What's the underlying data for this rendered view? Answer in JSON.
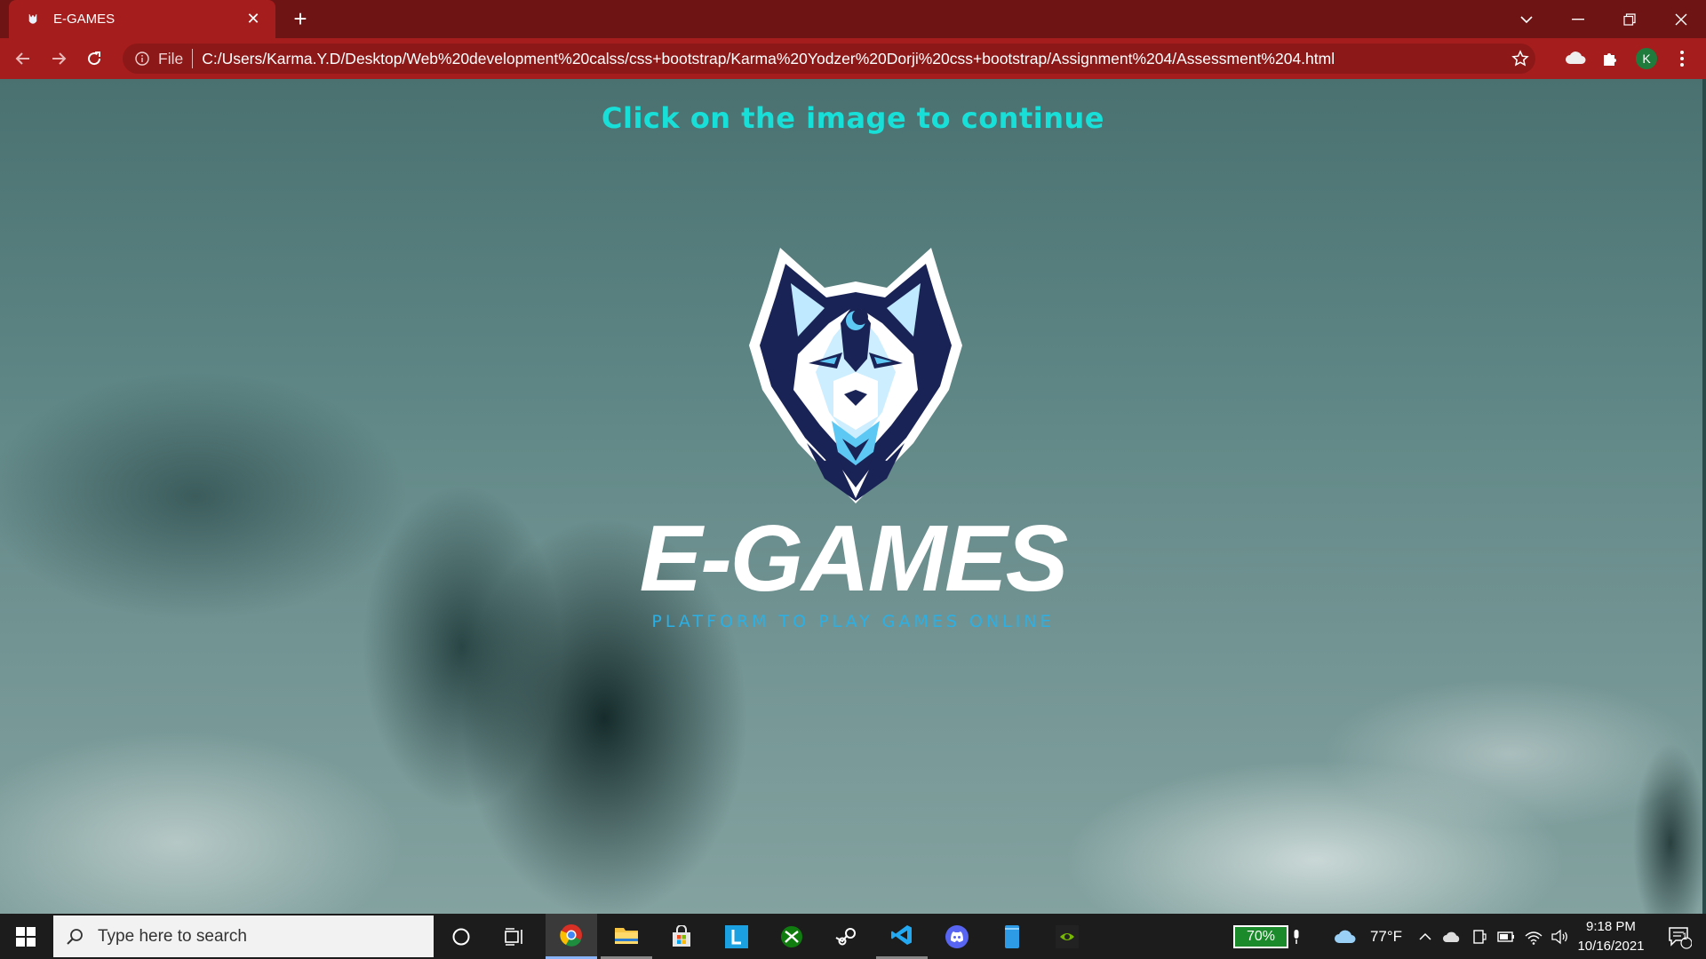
{
  "browser": {
    "tab_title": "E-GAMES",
    "tab_close": "✕",
    "new_tab": "+",
    "omnibox": {
      "scheme_label": "File",
      "url": "C:/Users/Karma.Y.D/Desktop/Web%20development%20calss/css+bootstrap/Karma%20Yodzer%20Dorji%20css+bootstrap/Assignment%204/Assessment%204.html"
    },
    "profile_initial": "K"
  },
  "page": {
    "cta_text": "Click on the image to continue",
    "brand_name": "E-GAMES",
    "brand_tagline": "PLATFORM TO PLAY GAMES ONLINE",
    "colors": {
      "cta": "#18e0d8",
      "tagline": "#2bb0e6",
      "chrome": "#a51d1d"
    }
  },
  "taskbar": {
    "search_placeholder": "Type here to search",
    "battery": "70%",
    "weather": "77°F",
    "time": "9:18 PM",
    "date": "10/16/2021",
    "notification_count": "1"
  }
}
